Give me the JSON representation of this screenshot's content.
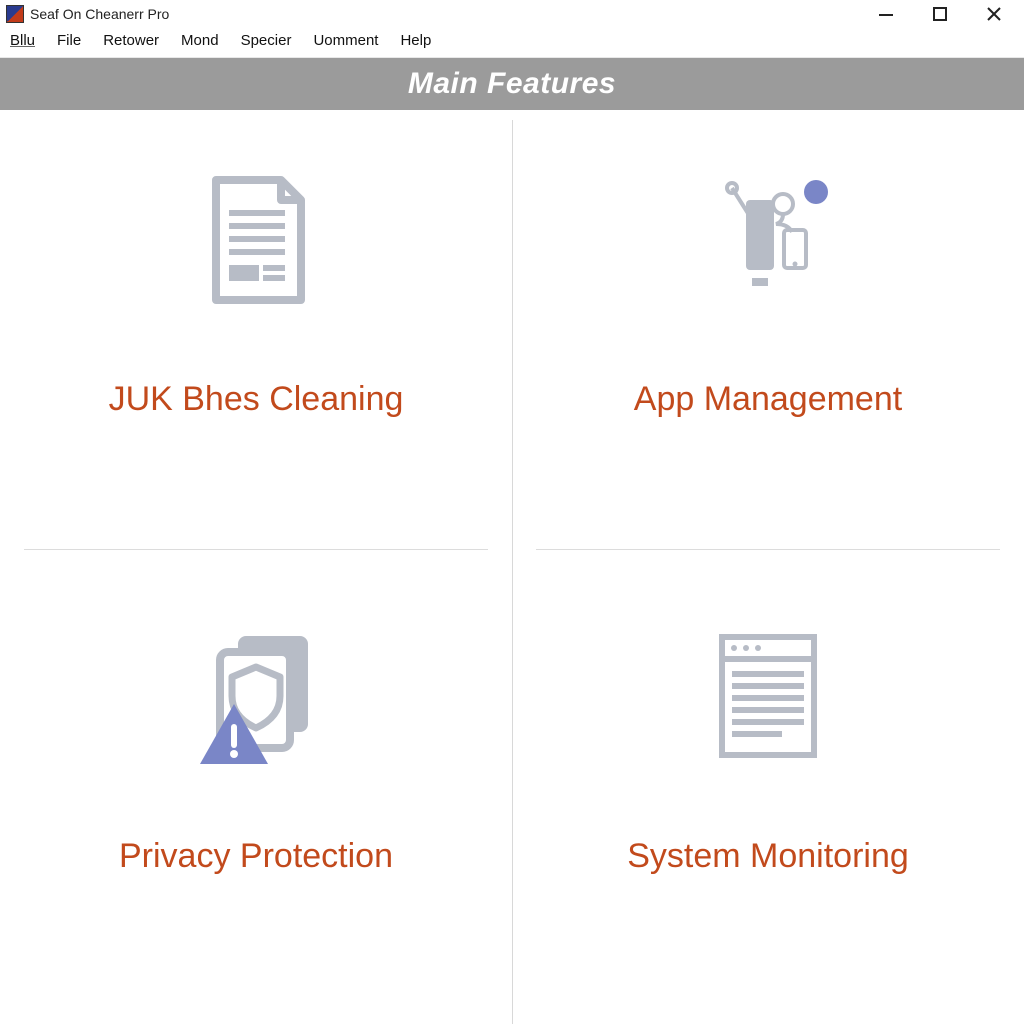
{
  "window": {
    "title": "Seaf On Cheanerr Pro"
  },
  "menu": {
    "items": [
      "Bllu",
      "File",
      "Retower",
      "Mond",
      "Specier",
      "Uomment",
      "Help"
    ]
  },
  "header": {
    "title": "Main Features"
  },
  "features": [
    {
      "label": "JUK Bhes Cleaning",
      "icon": "document-icon"
    },
    {
      "label": "App Management",
      "icon": "apps-icon"
    },
    {
      "label": "Privacy Protection",
      "icon": "privacy-shield-icon"
    },
    {
      "label": "System Monitoring",
      "icon": "monitor-icon"
    }
  ],
  "colors": {
    "accent_text": "#c24a1c",
    "header_bg": "#9b9b9b",
    "icon_gray": "#b7bcc6",
    "icon_blue": "#7a86c7"
  }
}
